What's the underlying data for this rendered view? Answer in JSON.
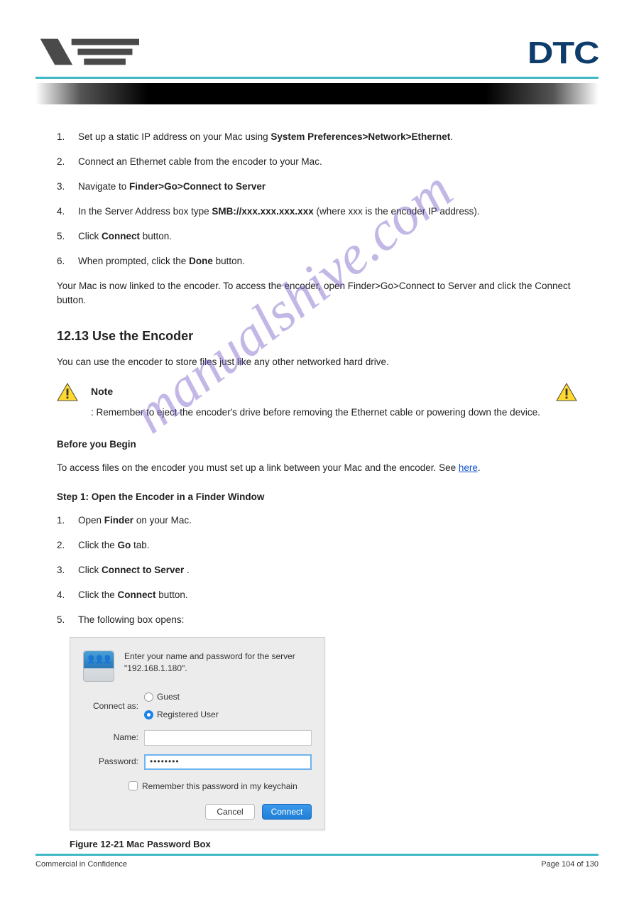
{
  "header": {
    "right_logo_text": "DTC"
  },
  "section12": {
    "items": [
      {
        "n": "1.",
        "text": "Set up a static IP address on your Mac using "
      },
      {
        "n": "2.",
        "text": "Connect an Ethernet cable from the encoder to your Mac."
      },
      {
        "n": "3.",
        "text": "Navigate to "
      },
      {
        "n": "4.",
        "text": "In the Server Address box type "
      },
      {
        "n": "5.",
        "text": "Click "
      },
      {
        "n": "6.",
        "text": "When prompted, click the "
      }
    ],
    "bold3": "Finder>Go>Connect to Server",
    "bold4": "SMB://xxx.xxx.xxx.xxx",
    "tail4": " (where xxx is the encoder IP address).",
    "bold5a": "Connect",
    "tail5": " button.",
    "bold6a": "Done",
    "tail6": " button.",
    "closing": "Your Mac is now linked to the encoder. To access the encoder, open ",
    "closing_b": "Finder>Go>Connect to Server",
    "closing2": " and click the ",
    "closing_b2": "Connect",
    "closing3": " button."
  },
  "section13": {
    "heading": "12.13 Use the Encoder",
    "intro": "You can use the encoder to store files just like any other networked hard drive.",
    "note_label": "Note",
    "note_body": ": Remember to eject the encoder's drive before removing the Ethernet cable or powering down the device.",
    "before_h": "Before you Begin",
    "before_p": "To access files on the encoder you must set up a link between your Mac and the encoder.",
    "s1n": "Step 1: Open the Encoder in a Finder Window",
    "s1_items": [
      {
        "n": "1.",
        "pre": "Open ",
        "b": "Finder",
        "mid": " on your Mac."
      },
      {
        "n": "2.",
        "pre": "Click the ",
        "b": "Go",
        "mid": " tab."
      },
      {
        "n": "3.",
        "pre": "Click ",
        "b": "Connect to Server",
        "mid": "."
      },
      {
        "n": "4.",
        "pre": "Click the ",
        "b": "Connect",
        "mid": " button."
      },
      {
        "n": "5.",
        "pre": "The following box opens:"
      }
    ],
    "see_link": "here"
  },
  "dialog": {
    "message": "Enter your name and password for the server \"192.168.1.180\".",
    "connect_as": "Connect as:",
    "guest": "Guest",
    "registered": "Registered User",
    "name_label": "Name:",
    "name_value": "",
    "pwd_label": "Password:",
    "pwd_value": "••••••••",
    "remember": "Remember this password in my keychain",
    "cancel": "Cancel",
    "connect": "Connect"
  },
  "figure": "Figure 12-21 Mac Password Box",
  "footer": {
    "left": "Commercial in Confidence",
    "right": "Page 104 of 130"
  },
  "watermark": "manualshive.com"
}
